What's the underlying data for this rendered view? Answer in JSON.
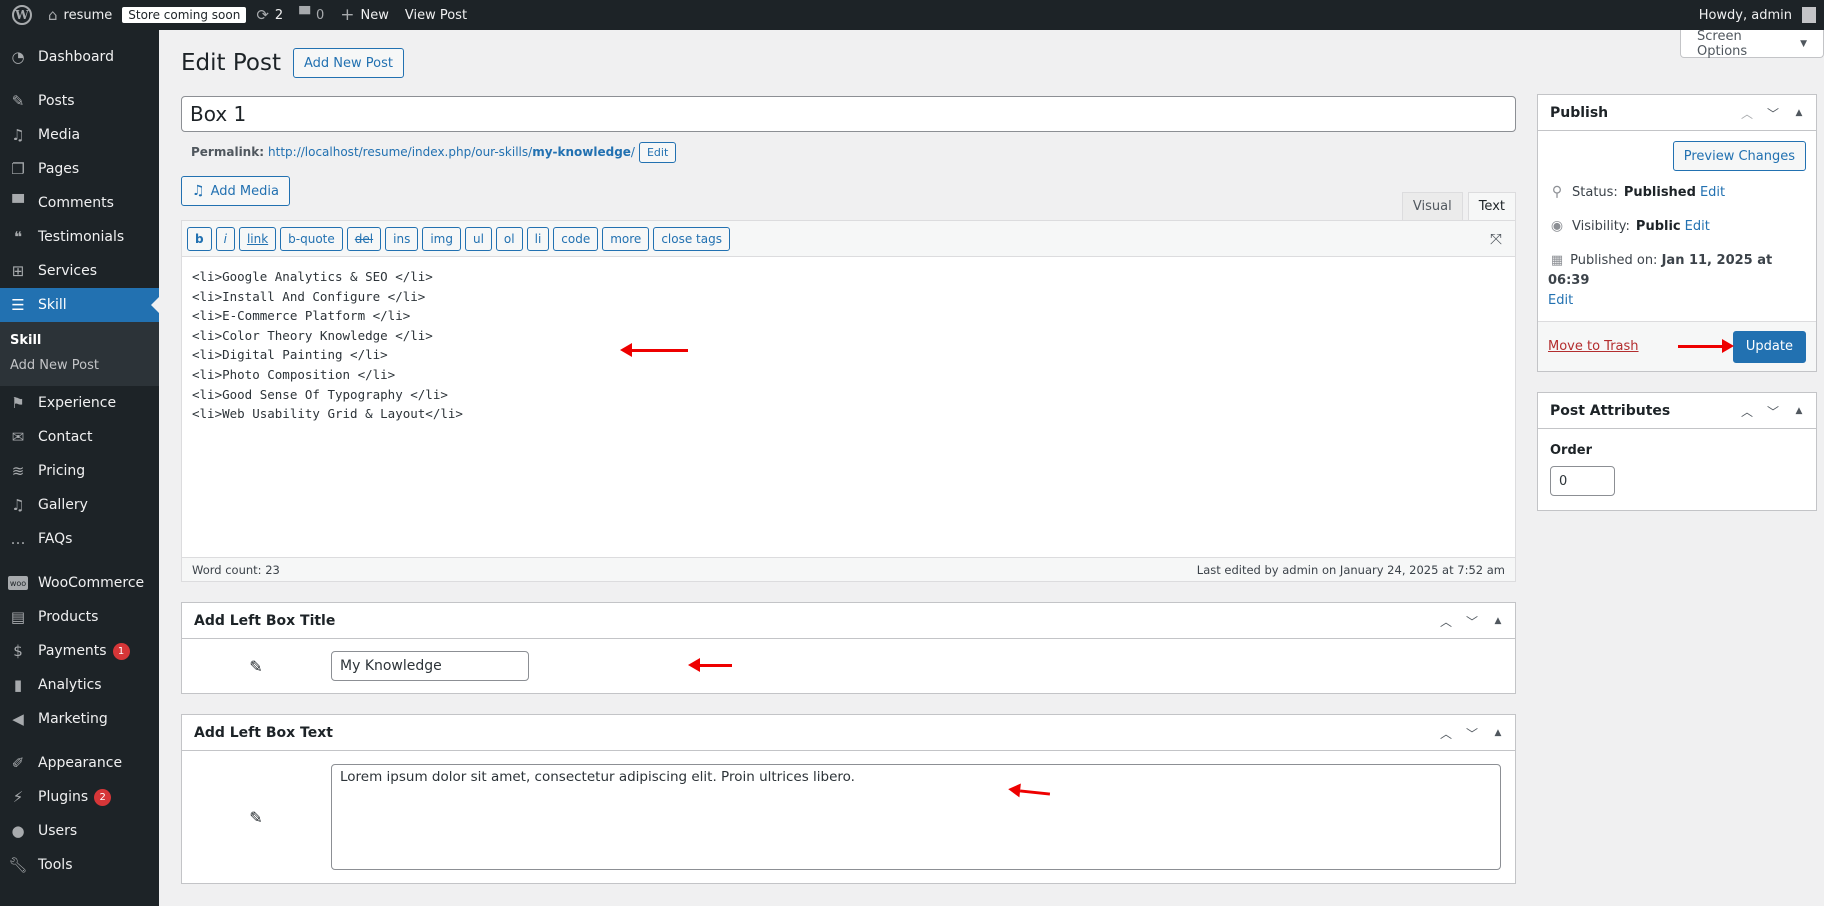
{
  "adminbar": {
    "site_name": "resume",
    "store_badge": "Store coming soon",
    "updates_count": "2",
    "comments_count": "0",
    "new_label": "New",
    "view_post_label": "View Post",
    "greeting": "Howdy, admin"
  },
  "screen_options": "Screen Options",
  "sidebar": {
    "items": [
      {
        "label": "Dashboard",
        "icon": "dashboard-icon"
      },
      {
        "label": "Posts",
        "icon": "pin-icon"
      },
      {
        "label": "Media",
        "icon": "media-icon"
      },
      {
        "label": "Pages",
        "icon": "pages-icon"
      },
      {
        "label": "Comments",
        "icon": "comment-icon"
      },
      {
        "label": "Testimonials",
        "icon": "testimonials-icon"
      },
      {
        "label": "Services",
        "icon": "grid-icon"
      },
      {
        "label": "Skill",
        "icon": "list-icon"
      },
      {
        "label": "Experience",
        "icon": "graduation-cap-icon"
      },
      {
        "label": "Contact",
        "icon": "envelope-icon"
      },
      {
        "label": "Pricing",
        "icon": "stack-icon"
      },
      {
        "label": "Gallery",
        "icon": "media-icon"
      },
      {
        "label": "FAQs",
        "icon": "chat-icon"
      },
      {
        "label": "WooCommerce",
        "icon": "woo-icon"
      },
      {
        "label": "Products",
        "icon": "archive-icon"
      },
      {
        "label": "Payments",
        "icon": "dollar-icon",
        "badge": "1"
      },
      {
        "label": "Analytics",
        "icon": "bar-chart-icon"
      },
      {
        "label": "Marketing",
        "icon": "megaphone-icon"
      },
      {
        "label": "Appearance",
        "icon": "paintbrush-icon"
      },
      {
        "label": "Plugins",
        "icon": "plugin-icon",
        "badge": "2"
      },
      {
        "label": "Users",
        "icon": "user-icon"
      },
      {
        "label": "Tools",
        "icon": "wrench-icon"
      }
    ],
    "submenu": {
      "current": "Skill",
      "add_new": "Add New Post"
    }
  },
  "page": {
    "title": "Edit Post",
    "add_new_label": "Add New Post",
    "post_title": "Box 1",
    "permalink_label": "Permalink:",
    "permalink_base": "http://localhost/resume/index.php/our-skills/",
    "permalink_slug": "my-knowledge",
    "permalink_trail": "/",
    "permalink_edit": "Edit"
  },
  "editor": {
    "add_media_label": "Add Media",
    "tabs": [
      "Visual",
      "Text"
    ],
    "active_tab": "Text",
    "quicktags": [
      "b",
      "i",
      "link",
      "b-quote",
      "del",
      "ins",
      "img",
      "ul",
      "ol",
      "li",
      "code",
      "more",
      "close tags"
    ],
    "content_lines": [
      "<li>Google Analytics & SEO </li>",
      "<li>Install And Configure </li>",
      "<li>E-Commerce Platform </li>",
      "<li>Color Theory Knowledge </li>",
      "<li>Digital Painting </li>",
      "<li>Photo Composition </li>",
      "<li>Good Sense Of Typography </li>",
      "<li>Web Usability Grid & Layout</li>"
    ],
    "word_count": "Word count: 23",
    "last_edited": "Last edited by admin on January 24, 2025 at 7:52 am"
  },
  "left_box_title": {
    "heading": "Add Left Box Title",
    "value": "My Knowledge"
  },
  "left_box_text": {
    "heading": "Add Left Box Text",
    "value": "Lorem ipsum dolor sit amet, consectetur adipiscing elit. Proin ultrices libero."
  },
  "publish": {
    "heading": "Publish",
    "preview_label": "Preview Changes",
    "status_label": "Status:",
    "status_value": "Published",
    "visibility_label": "Visibility:",
    "visibility_value": "Public",
    "published_label": "Published on:",
    "published_value": "Jan 11, 2025 at 06:39",
    "edit_label": "Edit",
    "trash_label": "Move to Trash",
    "update_label": "Update"
  },
  "post_attributes": {
    "heading": "Post Attributes",
    "order_label": "Order",
    "order_value": "0"
  }
}
